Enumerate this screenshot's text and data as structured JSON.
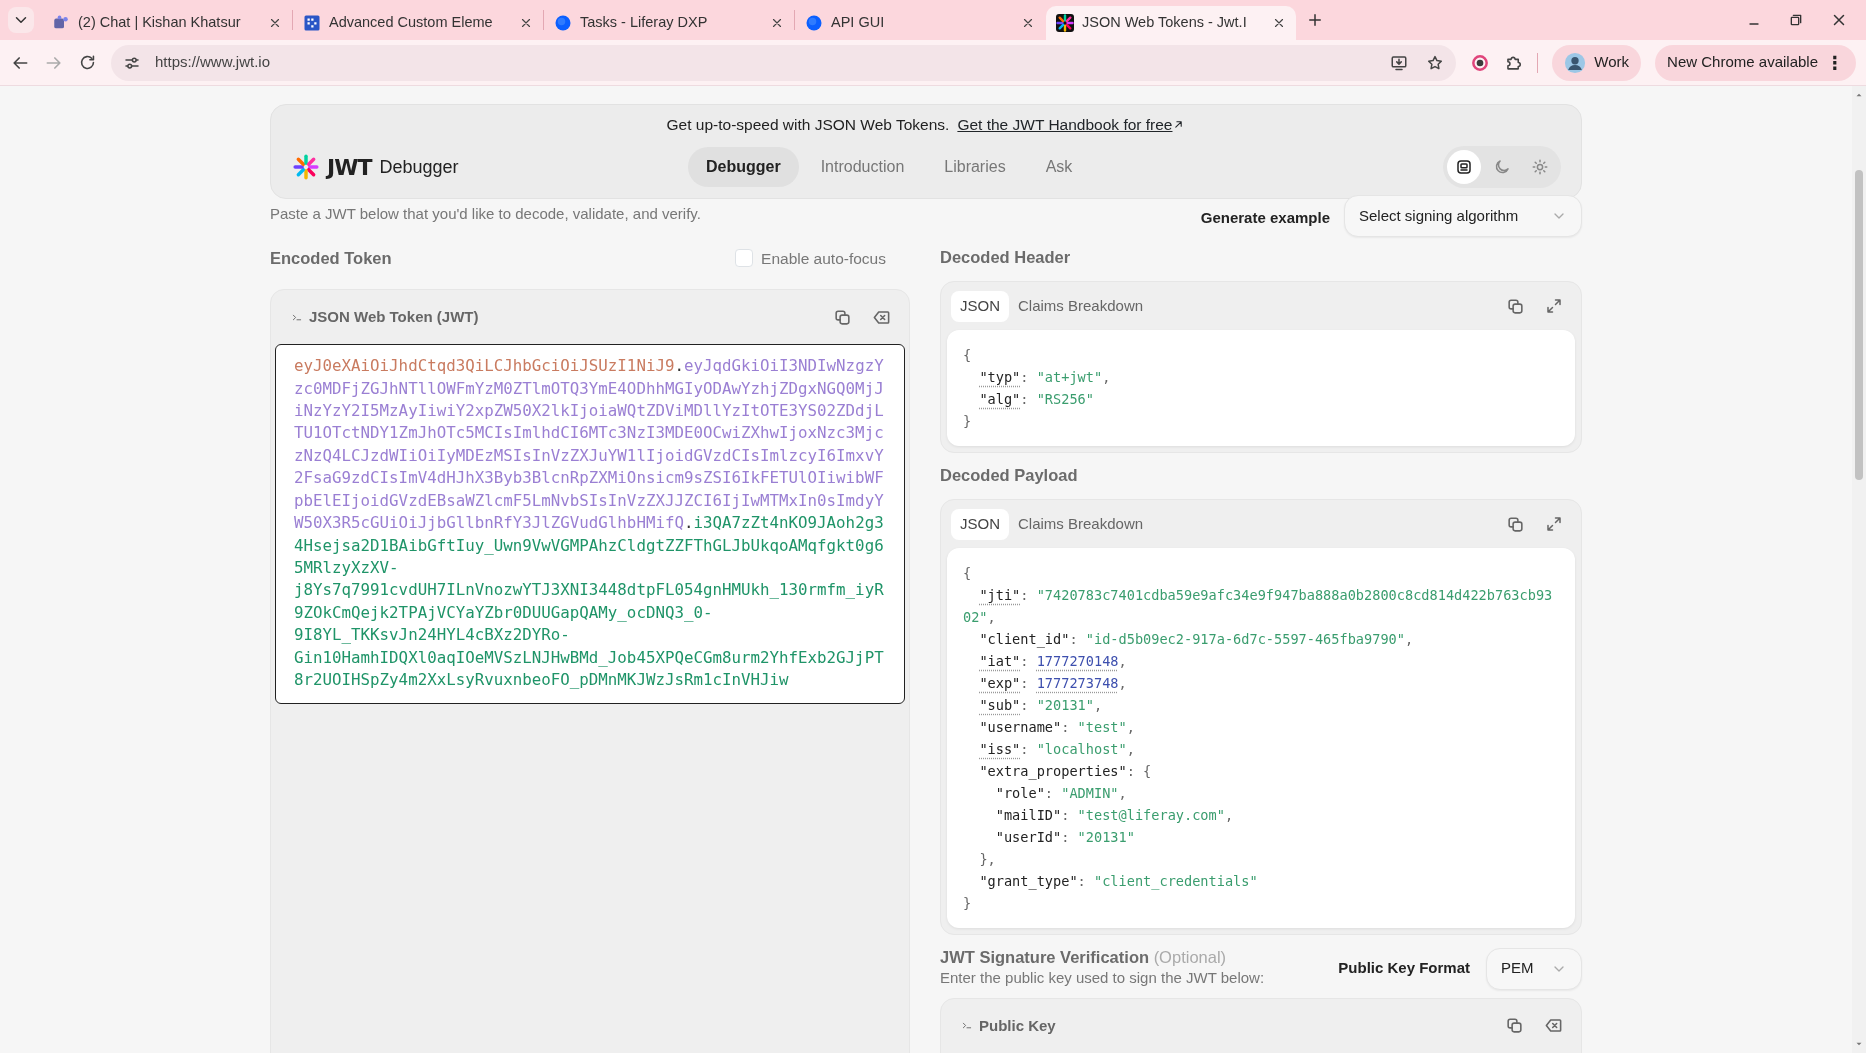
{
  "browser": {
    "tabs": [
      {
        "title": "(2) Chat | Kishan Khatsur",
        "kind": "chat",
        "selected": false
      },
      {
        "title": "Advanced Custom Eleme",
        "kind": "grid",
        "selected": false
      },
      {
        "title": "Tasks - Liferay DXP",
        "kind": "circle",
        "selected": false
      },
      {
        "title": "API GUI",
        "kind": "circle",
        "selected": false
      },
      {
        "title": "JSON Web Tokens - Jwt.I",
        "kind": "jwt",
        "selected": true
      }
    ],
    "url": "https://www.jwt.io",
    "profile": "Work",
    "update_button": "New Chrome available",
    "update_menu_glyph": "⋮"
  },
  "banner": {
    "text": "Get up-to-speed with JSON Web Tokens.",
    "link": "Get the JWT Handbook for free"
  },
  "header": {
    "logo": "JWT",
    "title": "Debugger",
    "nav": [
      {
        "label": "Debugger",
        "selected": true
      },
      {
        "label": "Introduction",
        "selected": false
      },
      {
        "label": "Libraries",
        "selected": false
      },
      {
        "label": "Ask",
        "selected": false
      }
    ],
    "theme_buttons": [
      {
        "kind": "system",
        "selected": true
      },
      {
        "kind": "dark",
        "selected": false
      },
      {
        "kind": "light",
        "selected": false
      }
    ]
  },
  "intro": "Paste a JWT below that you'd like to decode, validate, and verify.",
  "generate_label": "Generate example",
  "algorithm_select": {
    "placeholder": "Select signing algorithm"
  },
  "encoded": {
    "title": "Encoded Token",
    "autofocus": {
      "label": "Enable auto-focus",
      "checked": false
    },
    "panel_title": "JSON Web Token (JWT)",
    "token": [
      {
        "kind": "header",
        "text": "eyJ0eXAiOiJhdCtqd3QiLCJhbGciOiJSUzI1NiJ9"
      },
      {
        "kind": "dot",
        "text": "."
      },
      {
        "kind": "payload",
        "text": "eyJqdGkiOiI3NDIwNzgzYzc0MDFjZGJhNTllOWFmYzM0ZTlmOTQ3YmE4ODhhMGIyODAwYzhjZDgxNGQ0MjJiNzYzY2I5MzAyIiwiY2xpZW50X2lkIjoiaWQtZDViMDllYzItOTE3YS02ZDdjLTU1OTctNDY1ZmJhOTc5MCIsImlhdCI6MTc3NzI3MDE0OCwiZXhwIjoxNzc3MjczNzQ4LCJzdWIiOiIyMDEzMSIsInVzZXJuYW1lIjoidGVzdCIsImlzcyI6ImxvY2FsaG9zdCIsImV4dHJhX3Byb3BlcnRpZXMiOnsicm9sZSI6IkFETUlOIiwibWFpbElEIjoidGVzdEBsaWZlcmF5LmNvbSIsInVzZXJJZCI6IjIwMTMxIn0sImdyYW50X3R5cGUiOiJjbGllbnRfY3JlZGVudGlhbHMifQ"
      },
      {
        "kind": "dot",
        "text": "."
      },
      {
        "kind": "signature",
        "text": "i3QA7zZt4nKO9JAoh2g34Hsejsa2D1BAibGftIuy_Uwn9VwVGMPAhzCldgtZZFThGLJbUkqoAMqfgkt0g65MRlzyXzXV-j8Ys7q7991cvdUH7ILnVnozwYTJ3XNI3448dtpFL054gnHMUkh_130rmfm_iyR9ZOkCmQejk2TPAjVCYaYZbr0DUUGapQAMy_ocDNQ3_0-9I8YL_TKKsvJn24HYL4cBXz2DYRo-Gin10HamhIDQXl0aqIOeMVSzLNJHwBMd_Job45XPQeCGm8urm2YhfExb2GJjPT8r2UOIHSpZy4m2XxLsyRvuxnbeoFO_pDMnMKJWzJsRm1cInVHJiw"
      }
    ]
  },
  "decoded_header": {
    "title": "Decoded Header",
    "view_tabs": [
      {
        "label": "JSON",
        "selected": true
      },
      {
        "label": "Claims Breakdown",
        "selected": false
      }
    ],
    "lines": [
      [
        {
          "kind": "punct",
          "text": "{"
        }
      ],
      [
        {
          "kind": "claim",
          "text": "  \"typ\""
        },
        {
          "kind": "punct",
          "text": ": "
        },
        {
          "kind": "string",
          "text": "\"at+jwt\""
        },
        {
          "kind": "punct",
          "text": ","
        }
      ],
      [
        {
          "kind": "claim",
          "text": "  \"alg\""
        },
        {
          "kind": "punct",
          "text": ": "
        },
        {
          "kind": "string",
          "text": "\"RS256\""
        }
      ],
      [
        {
          "kind": "punct",
          "text": "}"
        }
      ]
    ]
  },
  "decoded_payload": {
    "title": "Decoded Payload",
    "view_tabs": [
      {
        "label": "JSON",
        "selected": true
      },
      {
        "label": "Claims Breakdown",
        "selected": false
      }
    ],
    "lines": [
      [
        {
          "kind": "punct",
          "text": "{"
        }
      ],
      [
        {
          "kind": "claim",
          "text": "  \"jti\""
        },
        {
          "kind": "punct",
          "text": ": "
        },
        {
          "kind": "string",
          "text": "\"7420783c7401cdba59e9afc34e9f947ba888a0b2800c8cd814d422b763cb9302\""
        },
        {
          "kind": "punct",
          "text": ","
        }
      ],
      [
        {
          "kind": "key",
          "text": "  \"client_id\""
        },
        {
          "kind": "punct",
          "text": ": "
        },
        {
          "kind": "string",
          "text": "\"id-d5b09ec2-917a-6d7c-5597-465fba9790\""
        },
        {
          "kind": "punct",
          "text": ","
        }
      ],
      [
        {
          "kind": "claim",
          "text": "  \"iat\""
        },
        {
          "kind": "punct",
          "text": ": "
        },
        {
          "kind": "number",
          "text": "1777270148"
        },
        {
          "kind": "punct",
          "text": ","
        }
      ],
      [
        {
          "kind": "claim",
          "text": "  \"exp\""
        },
        {
          "kind": "punct",
          "text": ": "
        },
        {
          "kind": "number",
          "text": "1777273748"
        },
        {
          "kind": "punct",
          "text": ","
        }
      ],
      [
        {
          "kind": "claim",
          "text": "  \"sub\""
        },
        {
          "kind": "punct",
          "text": ": "
        },
        {
          "kind": "string",
          "text": "\"20131\""
        },
        {
          "kind": "punct",
          "text": ","
        }
      ],
      [
        {
          "kind": "key",
          "text": "  \"username\""
        },
        {
          "kind": "punct",
          "text": ": "
        },
        {
          "kind": "string",
          "text": "\"test\""
        },
        {
          "kind": "punct",
          "text": ","
        }
      ],
      [
        {
          "kind": "claim",
          "text": "  \"iss\""
        },
        {
          "kind": "punct",
          "text": ": "
        },
        {
          "kind": "string",
          "text": "\"localhost\""
        },
        {
          "kind": "punct",
          "text": ","
        }
      ],
      [
        {
          "kind": "key",
          "text": "  \"extra_properties\""
        },
        {
          "kind": "punct",
          "text": ": {"
        }
      ],
      [
        {
          "kind": "key",
          "text": "    \"role\""
        },
        {
          "kind": "punct",
          "text": ": "
        },
        {
          "kind": "string",
          "text": "\"ADMIN\""
        },
        {
          "kind": "punct",
          "text": ","
        }
      ],
      [
        {
          "kind": "key",
          "text": "    \"mailID\""
        },
        {
          "kind": "punct",
          "text": ": "
        },
        {
          "kind": "string",
          "text": "\"test@liferay.com\""
        },
        {
          "kind": "punct",
          "text": ","
        }
      ],
      [
        {
          "kind": "key",
          "text": "    \"userId\""
        },
        {
          "kind": "punct",
          "text": ": "
        },
        {
          "kind": "string",
          "text": "\"20131\""
        }
      ],
      [
        {
          "kind": "punct",
          "text": "  },"
        }
      ],
      [
        {
          "kind": "key",
          "text": "  \"grant_type\""
        },
        {
          "kind": "punct",
          "text": ": "
        },
        {
          "kind": "string",
          "text": "\"client_credentials\""
        }
      ],
      [
        {
          "kind": "punct",
          "text": "}"
        }
      ]
    ]
  },
  "signature": {
    "title": "JWT Signature Verification",
    "optional": "(Optional)",
    "subtitle": "Enter the public key used to sign the JWT below:",
    "format_label": "Public Key Format",
    "format_select": "PEM",
    "panel_title": "Public Key"
  }
}
